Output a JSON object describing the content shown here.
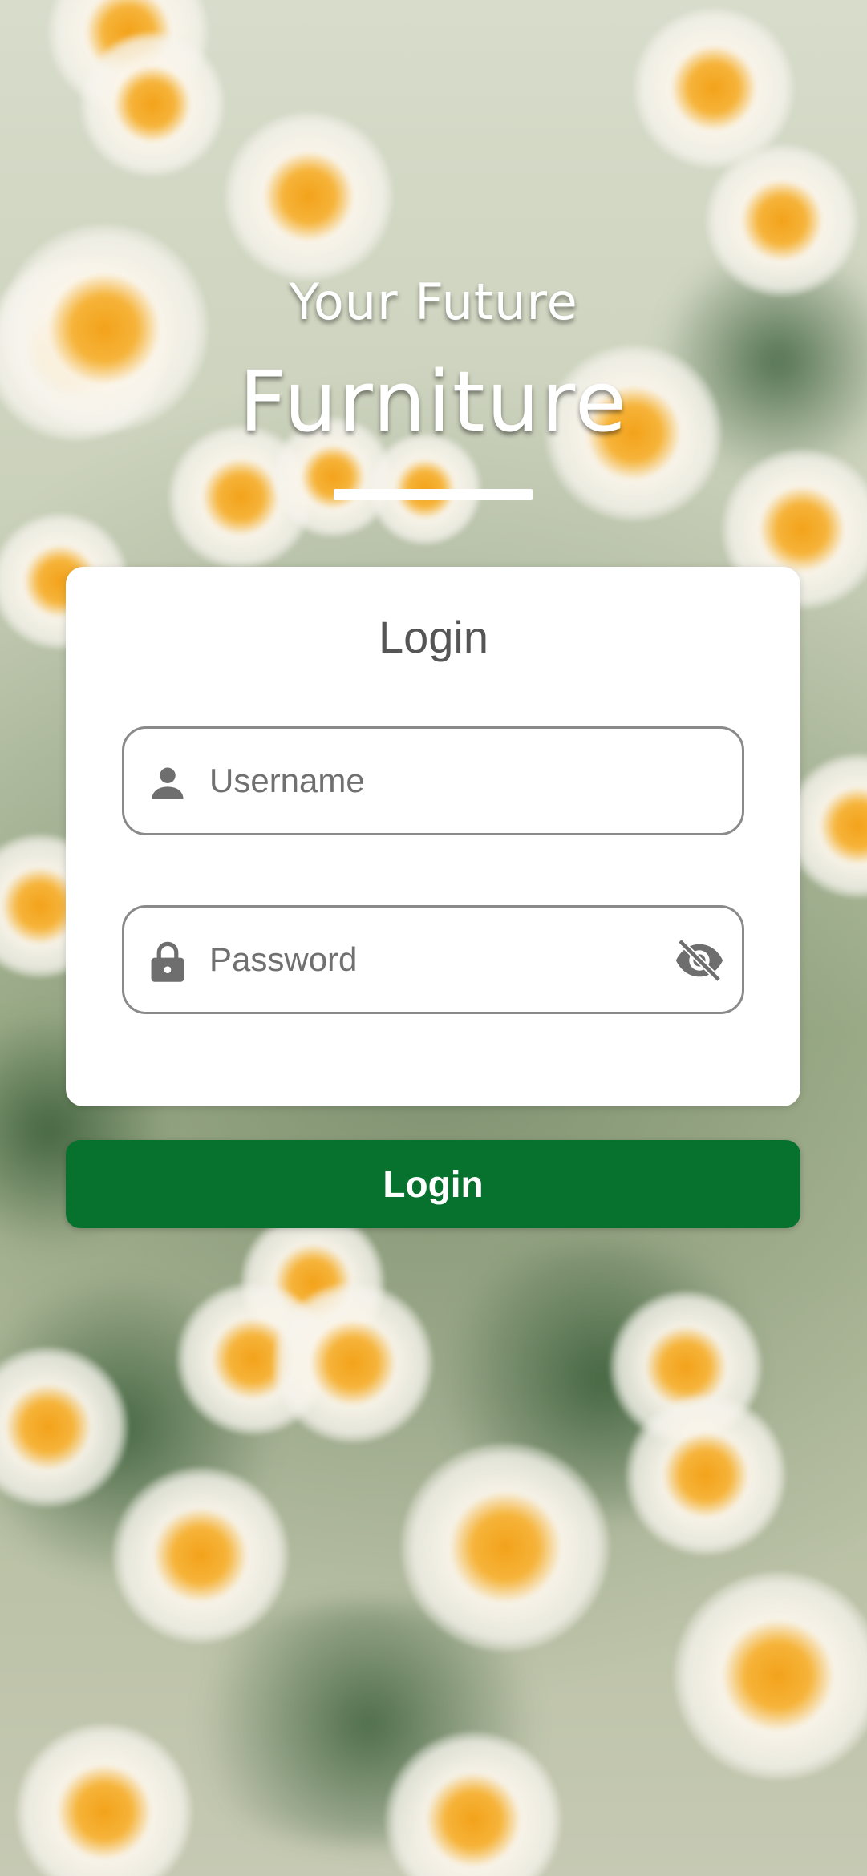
{
  "header": {
    "subtitle": "Your Future",
    "title": "Furniture"
  },
  "login_card": {
    "title": "Login",
    "username": {
      "value": "",
      "placeholder": "Username",
      "icon": "person-icon"
    },
    "password": {
      "value": "",
      "placeholder": "Password",
      "icon": "lock-icon",
      "toggle_icon": "eye-off-icon"
    }
  },
  "login_button": {
    "label": "Login"
  },
  "colors": {
    "button_green": "#06722e",
    "card_background": "#ffffff",
    "field_border": "#8a8a8a",
    "icon_gray": "#6e6e6e"
  }
}
